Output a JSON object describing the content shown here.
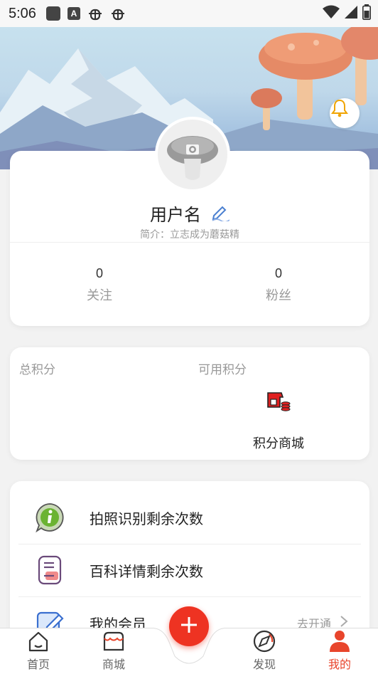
{
  "status_bar": {
    "time": "5:06",
    "icons": [
      "square-icon",
      "a-icon",
      "bug-icon",
      "bug-icon",
      "wifi-icon",
      "signal-icon",
      "battery-icon"
    ]
  },
  "profile": {
    "username": "用户名",
    "bio": "简介：立志成为蘑菇精",
    "stats": [
      {
        "value": "0",
        "label": "关注"
      },
      {
        "value": "0",
        "label": "粉丝"
      }
    ]
  },
  "points": {
    "total_label": "总积分",
    "available_label": "可用积分",
    "mall_label": "积分商城"
  },
  "list": {
    "items": [
      {
        "label": "拍照识别剩余次数",
        "icon": "info-chat-icon"
      },
      {
        "label": "百科详情剩余次数",
        "icon": "document-icon"
      },
      {
        "label": "我的会员",
        "icon": "edit-icon",
        "right_text": "去开通"
      }
    ]
  },
  "tabbar": {
    "tabs": [
      {
        "label": "首页",
        "icon": "home-icon"
      },
      {
        "label": "商城",
        "icon": "shop-icon"
      },
      {
        "label": "发现",
        "icon": "compass-icon"
      },
      {
        "label": "我的",
        "icon": "user-icon",
        "active": true
      }
    ]
  },
  "colors": {
    "accent": "#e8452c",
    "fab": "#ee3322",
    "muted_text": "#999999"
  }
}
